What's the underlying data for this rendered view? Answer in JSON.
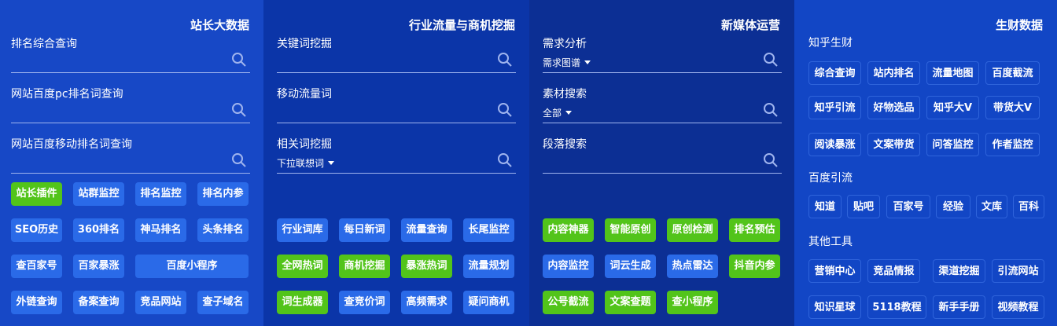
{
  "panels": [
    {
      "title": "站长大数据",
      "fields": [
        {
          "label": "排名综合查询"
        },
        {
          "label": "网站百度pc排名词查询"
        },
        {
          "label": "网站百度移动排名词查询"
        }
      ],
      "buttons": [
        "站长插件",
        "站群监控",
        "排名监控",
        "排名内参",
        "SEO历史",
        "360排名",
        "神马排名",
        "头条排名",
        "查百家号",
        "百家暴涨",
        "百度小程序",
        "外链查询",
        "备案查询",
        "竞品网站",
        "查子域名"
      ]
    },
    {
      "title": "行业流量与商机挖掘",
      "fields": [
        {
          "label": "关键词挖掘"
        },
        {
          "label": "移动流量词"
        },
        {
          "label": "相关词挖掘",
          "dropdown": "下拉联想词"
        }
      ],
      "buttons": [
        "行业词库",
        "每日新词",
        "流量查询",
        "长尾监控",
        "全网热词",
        "商机挖掘",
        "暴涨热词",
        "流量规划",
        "词生成器",
        "查竞价词",
        "高频需求",
        "疑问商机"
      ]
    },
    {
      "title": "新媒体运营",
      "fields": [
        {
          "label": "需求分析",
          "dropdown": "需求图谱"
        },
        {
          "label": "素材搜索",
          "dropdown": "全部"
        },
        {
          "label": "段落搜索"
        }
      ],
      "buttons": [
        "内容神器",
        "智能原创",
        "原创检测",
        "排名预估",
        "内容监控",
        "词云生成",
        "热点雷达",
        "抖音内参",
        "公号截流",
        "文案查题",
        "查小程序"
      ]
    },
    {
      "title": "生财数据",
      "sections": [
        {
          "label": "知乎生财",
          "buttons": [
            "综合查询",
            "站内排名",
            "流量地图",
            "百度截流",
            "知乎引流",
            "好物选品",
            "知乎大V",
            "带货大V",
            "阅读暴涨",
            "文案带货",
            "问答监控",
            "作者监控"
          ]
        },
        {
          "label": "百度引流",
          "buttons": [
            "知道",
            "贴吧",
            "百家号",
            "经验",
            "文库",
            "百科"
          ]
        },
        {
          "label": "其他工具",
          "buttons": [
            "营销中心",
            "竞品情报",
            "渠道挖掘",
            "引流网站",
            "知识星球",
            "5118教程",
            "新手手册",
            "视频教程"
          ]
        }
      ]
    }
  ],
  "colors": {
    "green": "#52c41a",
    "blue_button": "#2a6ae8",
    "panel1": "#1748c6",
    "panel2": "#0b35a8",
    "panel3": "#0c2f94",
    "panel4": "#1246c5"
  },
  "icons": {
    "search": "search-icon",
    "dropdown": "caret-down-icon"
  }
}
